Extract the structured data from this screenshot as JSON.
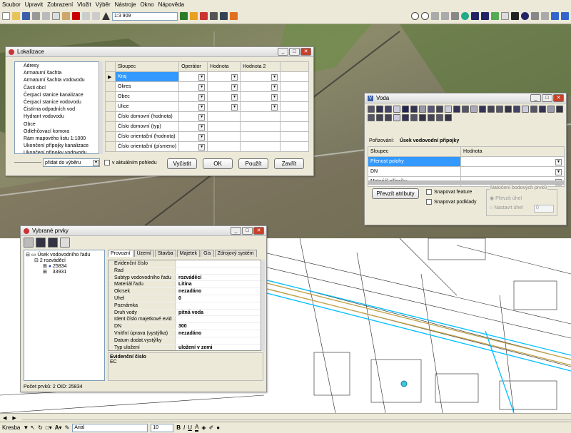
{
  "menu": [
    "Soubor",
    "Upravit",
    "Zobrazení",
    "Vložit",
    "Výběr",
    "Nástroje",
    "Okno",
    "Nápověda"
  ],
  "toolbar": {
    "scale": "1:3 909"
  },
  "lokalizace": {
    "title": "Lokalizace",
    "layers": [
      "Adresy",
      "Armaturní šachta",
      "Armaturní šachta vodovodu",
      "Části obcí",
      "Čerpací stanice kanalizace",
      "Čerpací stanice vodovodu",
      "Čistírna odpadních vod",
      "Hydrant vodovodu",
      "Obce",
      "Odlehčovací komora",
      "Rám mapového listu 1:1000",
      "Ukončení přípojky kanalizace",
      "Ukončení přípojky vodovodu"
    ],
    "columns": [
      "Sloupec",
      "Operátor",
      "Hodnota",
      "Hodnota 2"
    ],
    "rows": [
      "Kraj",
      "Okres",
      "Obec",
      "Ulice",
      "Číslo domovní (hodnota)",
      "Číslo domovní (typ)",
      "Číslo orientační (hodnota)",
      "Číslo orientační (písmeno)"
    ],
    "mode": "přidat do výběru",
    "in_view": "v aktuálním pohledu",
    "btn_clear": "Vyčistit",
    "btn_ok": "OK",
    "btn_apply": "Použít",
    "btn_close": "Zavřít"
  },
  "voda": {
    "title": "Voda",
    "acq_label": "Pořizování:",
    "acq_value": "Úsek vodovodní přípojky",
    "columns": [
      "Sloupec",
      "Hodnota"
    ],
    "rows": [
      "Přenost polohy",
      "DN",
      "Materiál přípojky"
    ],
    "btn_transfer": "Převzít atributy",
    "snap_feature": "Snapovat feature",
    "snap_base": "Snapovat podklady",
    "rotation_group": "Natočení bodových prvků",
    "rotation_take": "Převzít úhel",
    "rotation_set": "Nastavit úhel",
    "rotation_value": "0"
  },
  "vybrane": {
    "title": "Vybrané prvky",
    "tree_root": "Úsek vodovodního řadu",
    "tree_child": "2 rozváděcí",
    "tree_items": [
      "25834",
      "33931"
    ],
    "tabs": [
      "Provozní",
      "Území",
      "Stavba",
      "Majetek",
      "Gis",
      "Zdrojový systém"
    ],
    "props": [
      [
        "Evidenční číslo",
        ""
      ],
      [
        "Řad",
        ""
      ],
      [
        "Subtyp vodovodního řadu",
        "rozváděcí"
      ],
      [
        "Materiál řadu",
        "Litina"
      ],
      [
        "Okrsek",
        "nezadáno"
      ],
      [
        "Úhel",
        "0"
      ],
      [
        "Poznámka",
        ""
      ],
      [
        "Druh vody",
        "pitná voda"
      ],
      [
        "Ident číslo majetkové evid",
        ""
      ],
      [
        "DN",
        "300"
      ],
      [
        "Vnitřní úprava (vystýlka)",
        "nezadáno"
      ],
      [
        "Datum dodat.vystýlky",
        ""
      ],
      [
        "Typ uložení",
        "uložení v zemi"
      ]
    ],
    "desc_title": "Evidenční číslo",
    "desc_text": "EC",
    "status": "Počet prvků: 2  OID: 25834"
  },
  "drawbar": {
    "draw": "Kresba",
    "font": "Arial",
    "size": "10",
    "bold": "B",
    "italic": "I",
    "underline": "U"
  },
  "colors": {
    "highlight": "#3399ff",
    "selection_line": "#00bfff"
  }
}
